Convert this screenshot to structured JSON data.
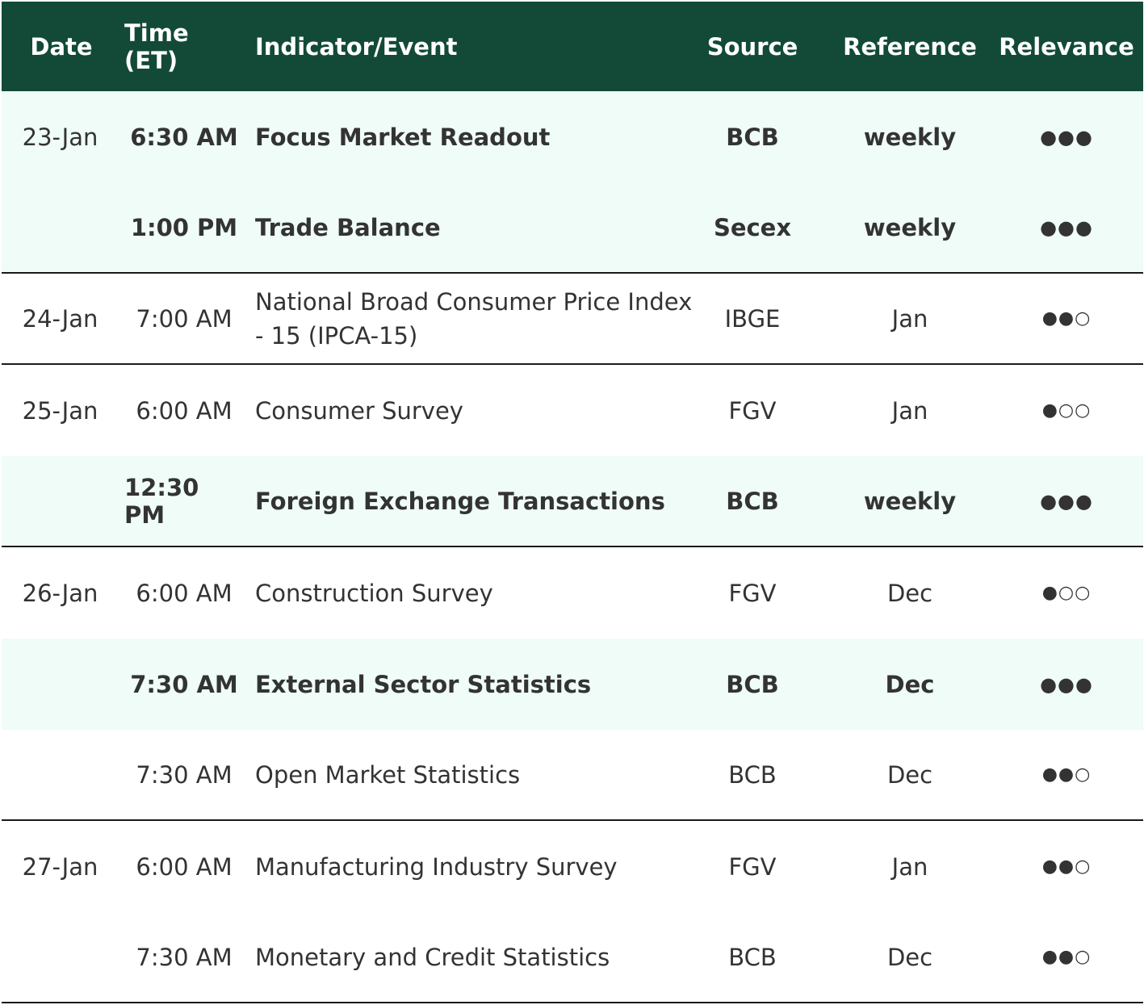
{
  "headers": {
    "date": "Date",
    "time": "Time (ET)",
    "indicator": "Indicator/Event",
    "source": "Source",
    "reference": "Reference",
    "relevance": "Relevance"
  },
  "rows": [
    {
      "date": "23-Jan",
      "time": "6:30 AM",
      "indicator": "Focus Market Readout",
      "source": "BCB",
      "reference": "weekly",
      "relevance": "●●●"
    },
    {
      "date": "",
      "time": "1:00 PM",
      "indicator": "Trade Balance",
      "source": "Secex",
      "reference": "weekly",
      "relevance": "●●●"
    },
    {
      "date": "24-Jan",
      "time": "7:00 AM",
      "indicator": "National Broad Consumer Price Index - 15 (IPCA-15)",
      "source": "IBGE",
      "reference": "Jan",
      "relevance": "●●○"
    },
    {
      "date": "25-Jan",
      "time": "6:00 AM",
      "indicator": "Consumer Survey",
      "source": "FGV",
      "reference": "Jan",
      "relevance": "●○○"
    },
    {
      "date": "",
      "time": "12:30 PM",
      "indicator": "Foreign Exchange Transactions",
      "source": "BCB",
      "reference": "weekly",
      "relevance": "●●●"
    },
    {
      "date": "26-Jan",
      "time": "6:00 AM",
      "indicator": "Construction Survey",
      "source": "FGV",
      "reference": "Dec",
      "relevance": "●○○"
    },
    {
      "date": "",
      "time": "7:30 AM",
      "indicator": "External Sector Statistics",
      "source": "BCB",
      "reference": "Dec",
      "relevance": "●●●"
    },
    {
      "date": "",
      "time": "7:30 AM",
      "indicator": "Open Market Statistics",
      "source": "BCB",
      "reference": "Dec",
      "relevance": "●●○"
    },
    {
      "date": "27-Jan",
      "time": "6:00 AM",
      "indicator": "Manufacturing Industry Survey",
      "source": "FGV",
      "reference": "Jan",
      "relevance": "●●○"
    },
    {
      "date": "",
      "time": "7:30 AM",
      "indicator": "Monetary and Credit Statistics",
      "source": "BCB",
      "reference": "Dec",
      "relevance": "●●○"
    }
  ],
  "colors": {
    "header_bg": "#124a37",
    "highlight_bg": "#effcf7",
    "text": "#333333"
  }
}
